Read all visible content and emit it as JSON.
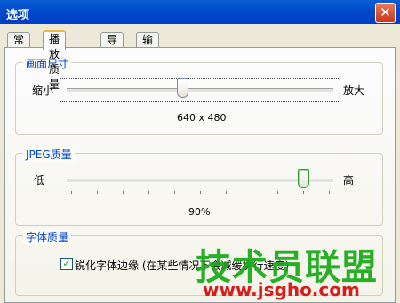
{
  "window": {
    "title": "选项",
    "close_glyph": "✕"
  },
  "tabs": [
    {
      "label": "常规",
      "active": false
    },
    {
      "label": "播放质量",
      "active": true
    },
    {
      "label": "导航",
      "active": false
    },
    {
      "label": "输出",
      "active": false
    }
  ],
  "picture_size": {
    "group_label": "画面尺寸",
    "min_label": "缩小",
    "max_label": "放大",
    "value_text": "640 x 480",
    "position": 0.43
  },
  "jpeg_quality": {
    "group_label": "JPEG质量",
    "min_label": "低",
    "max_label": "高",
    "value_text": "90%",
    "position": 0.9
  },
  "font_quality": {
    "group_label": "字体质量",
    "checkbox_label": "锐化字体边缘 (在某些情况下会减缓执行速度)",
    "checked": true,
    "check_glyph": "✓"
  },
  "watermark": {
    "text": "技术员联盟",
    "url": "www.jsgho.com"
  },
  "colors": {
    "title_bar": "#0047c8",
    "group_label": "#0046d5",
    "watermark_green": "#18a818",
    "watermark_red": "#d71c1c"
  }
}
